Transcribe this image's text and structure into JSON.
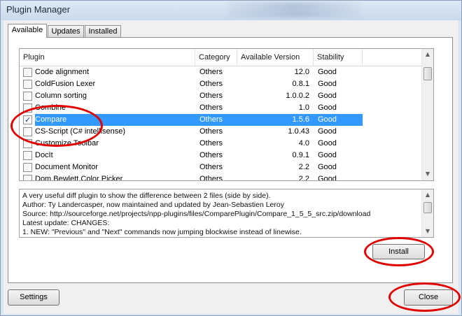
{
  "window": {
    "title": "Plugin Manager"
  },
  "tabs": [
    {
      "label": "Available",
      "active": true
    },
    {
      "label": "Updates",
      "active": false
    },
    {
      "label": "Installed",
      "active": false
    }
  ],
  "columns": {
    "plugin": "Plugin",
    "category": "Category",
    "version": "Available Version",
    "stability": "Stability"
  },
  "plugins": [
    {
      "name": "Code alignment",
      "category": "Others",
      "version": "12.0",
      "stability": "Good",
      "checked": false,
      "selected": false
    },
    {
      "name": "ColdFusion Lexer",
      "category": "Others",
      "version": "0.8.1",
      "stability": "Good",
      "checked": false,
      "selected": false
    },
    {
      "name": "Column sorting",
      "category": "Others",
      "version": "1.0.0.2",
      "stability": "Good",
      "checked": false,
      "selected": false
    },
    {
      "name": "Combine",
      "category": "Others",
      "version": "1.0",
      "stability": "Good",
      "checked": false,
      "selected": false
    },
    {
      "name": "Compare",
      "category": "Others",
      "version": "1.5.6",
      "stability": "Good",
      "checked": true,
      "selected": true
    },
    {
      "name": "CS-Script (C# intellisense)",
      "category": "Others",
      "version": "1.0.43",
      "stability": "Good",
      "checked": false,
      "selected": false
    },
    {
      "name": "Customize Toolbar",
      "category": "Others",
      "version": "4.0",
      "stability": "Good",
      "checked": false,
      "selected": false
    },
    {
      "name": "DocIt",
      "category": "Others",
      "version": "0.9.1",
      "stability": "Good",
      "checked": false,
      "selected": false
    },
    {
      "name": "Document Monitor",
      "category": "Others",
      "version": "2.2",
      "stability": "Good",
      "checked": false,
      "selected": false
    },
    {
      "name": "Dom Bewlett Color Picker",
      "category": "Others",
      "version": "2.2",
      "stability": "Good",
      "checked": false,
      "selected": false
    }
  ],
  "description": [
    "A very useful diff plugin to show the difference between 2 files (side by side).",
    "Author: Ty Landercasper, now maintained and updated by Jean-Sebastien Leroy",
    "Source: http://sourceforge.net/projects/npp-plugins/files/ComparePlugin/Compare_1_5_5_src.zip/download",
    "Latest update: CHANGES:",
    "1. NEW: \"Previous\" and \"Next\" commands now jumping blockwise instead of linewise."
  ],
  "buttons": {
    "install": "Install",
    "settings": "Settings",
    "close": "Close"
  },
  "icons": {
    "scroll_up": "scroll-up-icon",
    "scroll_down": "scroll-down-icon",
    "check": "checkmark-icon"
  },
  "colors": {
    "selection": "#3399ff",
    "annotation": "#e00000"
  }
}
